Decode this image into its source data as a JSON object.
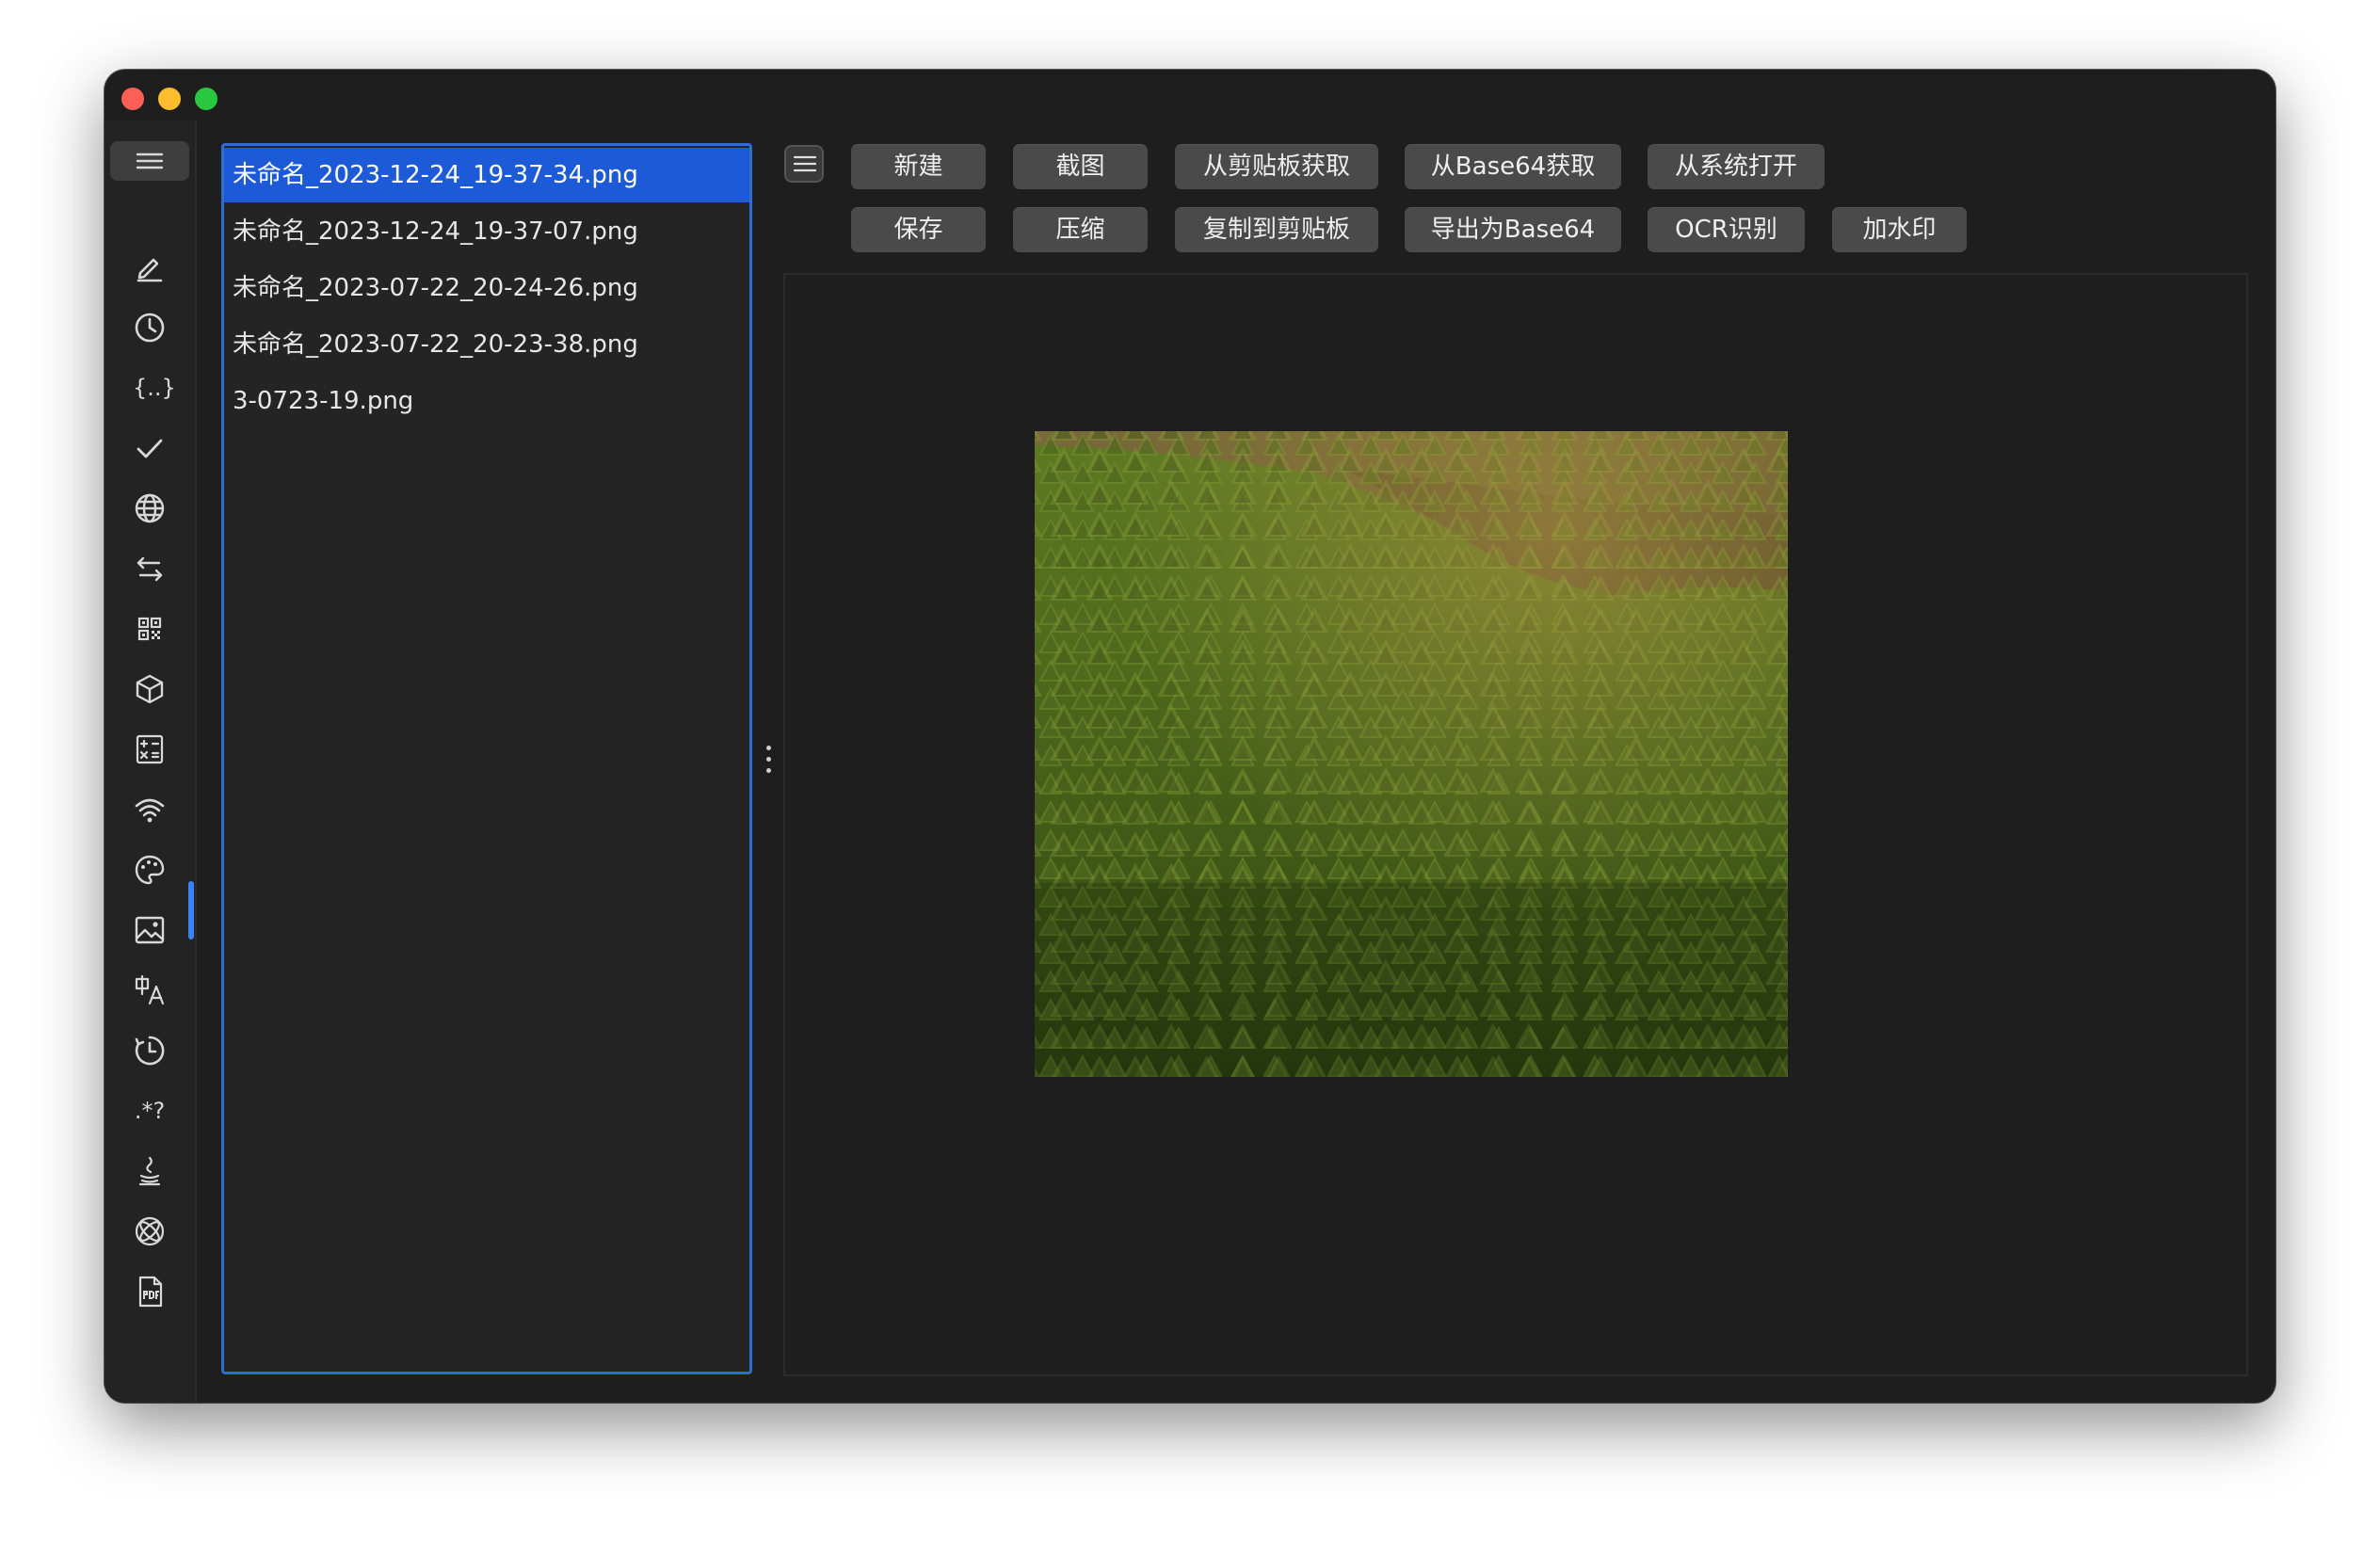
{
  "window": {
    "traffic_lights": [
      "close",
      "minimize",
      "maximize"
    ],
    "colors": {
      "close": "#fe5f57",
      "minimize": "#febc2e",
      "maximize": "#28c840",
      "accent": "#1d5ad7"
    }
  },
  "sidebar": {
    "menu_icon": "hamburger-icon",
    "active_item": "image-icon",
    "items": [
      {
        "icon": "pen-icon"
      },
      {
        "icon": "clock-icon"
      },
      {
        "icon": "braces-icon",
        "glyph": "{..}"
      },
      {
        "icon": "checkmark-icon"
      },
      {
        "icon": "globe-icon"
      },
      {
        "icon": "swap-arrows-icon"
      },
      {
        "icon": "qr-code-icon"
      },
      {
        "icon": "cube-icon"
      },
      {
        "icon": "calculator-icon"
      },
      {
        "icon": "wifi-icon"
      },
      {
        "icon": "palette-icon"
      },
      {
        "icon": "image-icon"
      },
      {
        "icon": "translate-icon"
      },
      {
        "icon": "timer-icon"
      },
      {
        "icon": "regex-icon",
        "glyph": ".*?"
      },
      {
        "icon": "java-icon"
      },
      {
        "icon": "atom-icon"
      },
      {
        "icon": "pdf-icon"
      }
    ]
  },
  "files": {
    "items": [
      {
        "name": "未命名_2023-12-24_19-37-34.png",
        "selected": true
      },
      {
        "name": "未命名_2023-12-24_19-37-07.png",
        "selected": false
      },
      {
        "name": "未命名_2023-07-22_20-24-26.png",
        "selected": false
      },
      {
        "name": "未命名_2023-07-22_20-23-38.png",
        "selected": false
      },
      {
        "name": "3-0723-19.png",
        "selected": false
      }
    ]
  },
  "toolbar": {
    "row1": {
      "new": "新建",
      "screenshot": "截图",
      "from_clipboard": "从剪贴板获取",
      "from_base64": "从Base64获取",
      "open_from_system": "从系统打开"
    },
    "row2": {
      "save": "保存",
      "compress": "压缩",
      "copy_to_clipboard": "复制到剪贴板",
      "export_base64": "导出为Base64",
      "ocr": "OCR识别",
      "watermark": "加水印"
    }
  },
  "preview": {
    "image_subject": "aerial-forest-photo"
  }
}
